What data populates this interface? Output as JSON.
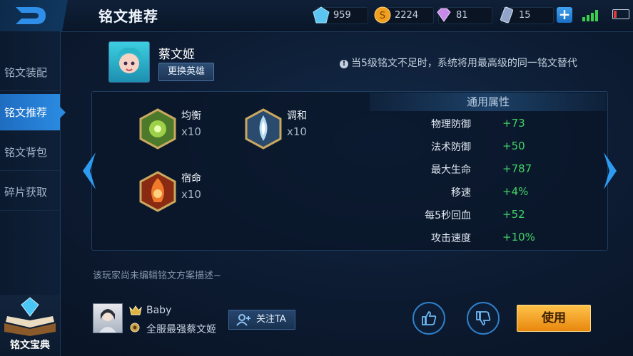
{
  "header": {
    "title": "铭文推荐",
    "resources": [
      {
        "name": "diamond",
        "icon": "diamond-icon",
        "value": "959"
      },
      {
        "name": "gold",
        "icon": "gold-coin-icon",
        "value": "2224"
      },
      {
        "name": "gem",
        "icon": "gem-icon",
        "value": "81"
      },
      {
        "name": "ticket",
        "icon": "ticket-icon",
        "value": "15"
      }
    ]
  },
  "sidebar": {
    "items": [
      {
        "label": "铭文装配"
      },
      {
        "label": "铭文推荐"
      },
      {
        "label": "铭文背包"
      },
      {
        "label": "碎片获取"
      }
    ],
    "book_label": "铭文宝典"
  },
  "hero": {
    "name": "蔡文姬",
    "swap_label": "更换英雄"
  },
  "notice": "当5级铭文不足时，系统将用最高级的同一铭文替代",
  "runes": [
    {
      "name": "均衡",
      "count": "x10",
      "color": "#7aa83a"
    },
    {
      "name": "调和",
      "count": "x10",
      "color": "#8fb8d8"
    },
    {
      "name": "宿命",
      "count": "x10",
      "color": "#d2502a"
    }
  ],
  "attributes": {
    "header": "通用属性",
    "rows": [
      {
        "name": "物理防御",
        "value": "+73"
      },
      {
        "name": "法术防御",
        "value": "+50"
      },
      {
        "name": "最大生命",
        "value": "+787"
      },
      {
        "name": "移速",
        "value": "+4%"
      },
      {
        "name": "每5秒回血",
        "value": "+52"
      },
      {
        "name": "攻击速度",
        "value": "+10%"
      }
    ]
  },
  "description": "该玩家尚未编辑铭文方案描述~",
  "author": {
    "name": "Baby",
    "title": "全服最强蔡文姬",
    "follow_label": "关注TA"
  },
  "actions": {
    "use_label": "使用"
  },
  "colors": {
    "accent": "#2a8ae0",
    "positive": "#42d266",
    "use_button": "#f5a623"
  }
}
